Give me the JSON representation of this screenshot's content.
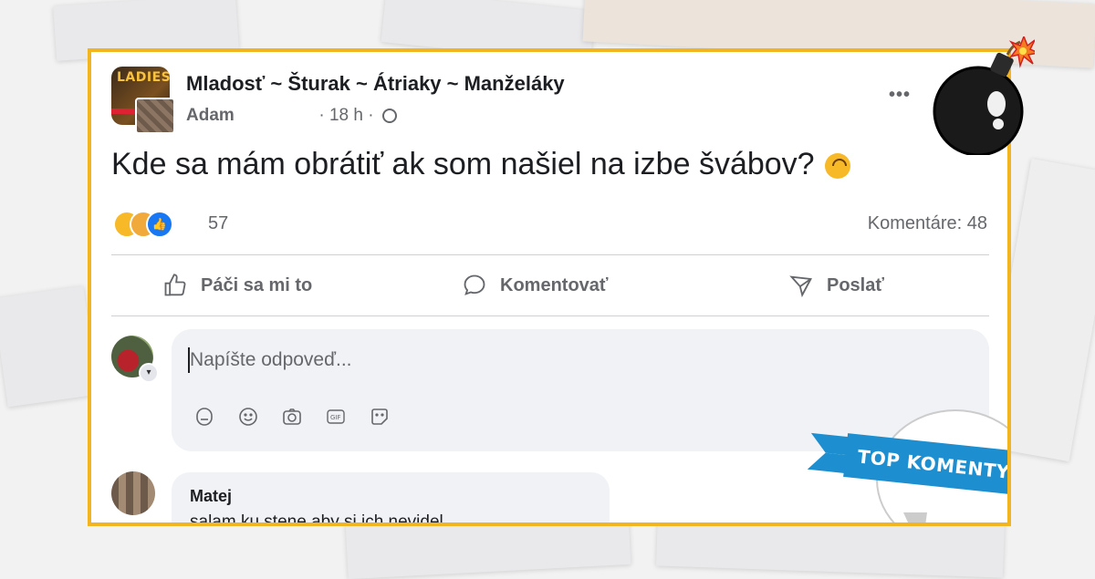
{
  "post": {
    "group_name": "Mladosť ~ Šturak ~ Átriaky ~ Manželáky",
    "group_logo_text": "LADIES",
    "author": "Adam",
    "time": "· 18 h ·",
    "text": "Kde sa mám obrátiť ak som našiel na izbe švábov?",
    "reaction_count": "57",
    "comments_label": "Komentáre: 48"
  },
  "actions": {
    "like": "Páči sa mi to",
    "comment": "Komentovať",
    "share": "Poslať"
  },
  "reply": {
    "placeholder": "Napíšte odpoveď..."
  },
  "comment": {
    "author": "Matej",
    "text": "salam ku stene aby si ich nevidel"
  },
  "badge": {
    "text": "TOP KOMENTY.SK"
  },
  "colors": {
    "frame": "#f2b51f",
    "facebook_blue": "#1877f2",
    "badge_blue": "#1d8fd0"
  },
  "icons": {
    "more": "more-dots-icon",
    "globe": "globe-icon",
    "like": "thumbs-up-icon",
    "comment": "speech-bubble-icon",
    "share": "send-icon",
    "sticker": "sticker-icon",
    "emoji": "smiley-icon",
    "camera": "camera-icon",
    "gif": "gif-icon",
    "avatar-sticker": "avatar-sticker-icon",
    "bomb": "bomb-icon"
  }
}
